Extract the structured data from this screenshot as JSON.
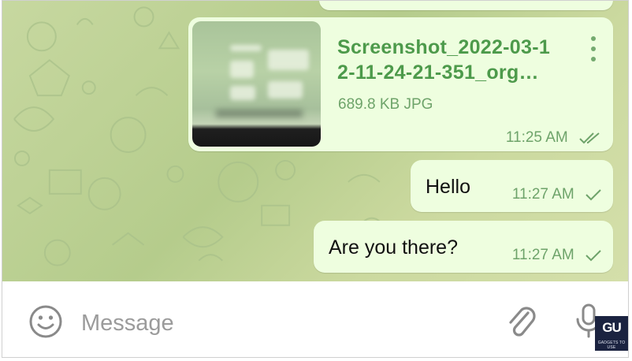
{
  "chat": {
    "file_message": {
      "file_name_line1": "Screenshot_2022-03-1",
      "file_name_line2": "2-11-24-21-351_org…",
      "file_info": "689.8 KB JPG",
      "time": "11:25 AM",
      "status_icon": "double-check-icon"
    },
    "messages": [
      {
        "text": "Hello",
        "time": "11:27 AM",
        "status_icon": "single-check-icon"
      },
      {
        "text": "Are you there?",
        "time": "11:27 AM",
        "status_icon": "single-check-icon"
      }
    ]
  },
  "input_bar": {
    "placeholder": "Message",
    "value": "",
    "icons": [
      "smile-icon",
      "paperclip-icon",
      "microphone-icon"
    ]
  },
  "watermark": {
    "logo": "GU",
    "text": "GADGETS TO USE"
  },
  "colors": {
    "bubble": "#eefedf",
    "accent": "#4d9a4b",
    "meta": "#6ea36a",
    "chat_background": "#bfd395"
  }
}
